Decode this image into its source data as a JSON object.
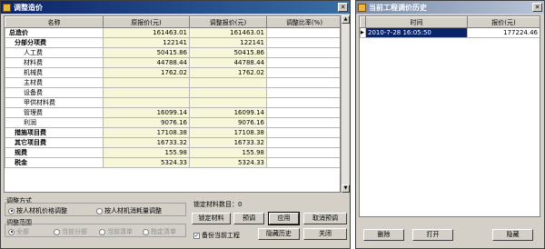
{
  "main_window": {
    "title": "调整造价",
    "columns": [
      "名称",
      "原报价(元)",
      "调整报价(元)",
      "调整比率(%)"
    ],
    "rows": [
      {
        "name": "总造价",
        "orig": "161463.01",
        "adj": "161463.01",
        "level": 1,
        "bold": true
      },
      {
        "name": "分部分项费",
        "orig": "122141",
        "adj": "122141",
        "level": 2,
        "bold": true
      },
      {
        "name": "人工费",
        "orig": "50415.86",
        "adj": "50415.86",
        "level": 3,
        "bold": false
      },
      {
        "name": "材料费",
        "orig": "44788.44",
        "adj": "44788.44",
        "level": 3,
        "bold": false
      },
      {
        "name": "机械费",
        "orig": "1762.02",
        "adj": "1762.02",
        "level": 3,
        "bold": false
      },
      {
        "name": "主材费",
        "orig": "",
        "adj": "",
        "level": 3,
        "bold": false
      },
      {
        "name": "设备费",
        "orig": "",
        "adj": "",
        "level": 3,
        "bold": false
      },
      {
        "name": "甲供材料费",
        "orig": "",
        "adj": "",
        "level": 3,
        "bold": false
      },
      {
        "name": "管理费",
        "orig": "16099.14",
        "adj": "16099.14",
        "level": 3,
        "bold": false
      },
      {
        "name": "利润",
        "orig": "9076.16",
        "adj": "9076.16",
        "level": 3,
        "bold": false
      },
      {
        "name": "措施项目费",
        "orig": "17108.38",
        "adj": "17108.38",
        "level": 2,
        "bold": true
      },
      {
        "name": "其它项目费",
        "orig": "16733.32",
        "adj": "16733.32",
        "level": 2,
        "bold": true
      },
      {
        "name": "规费",
        "orig": "155.98",
        "adj": "155.98",
        "level": 2,
        "bold": true
      },
      {
        "name": "税金",
        "orig": "5324.33",
        "adj": "5324.33",
        "level": 2,
        "bold": true
      }
    ],
    "adjust_method": {
      "label": "调整方式",
      "option_price": "按人材机价格调整",
      "option_qty": "按人材机消耗量调整"
    },
    "adjust_range": {
      "label": "调整范围",
      "options": [
        "全部",
        "当前分部",
        "当前清单",
        "指定清单"
      ]
    },
    "locked_count_label": "锁定材料数目：0",
    "buttons": {
      "lock_material": "锁定材料",
      "preview": "预调",
      "apply": "应用",
      "cancel_preview": "取消预调",
      "backup_label": "备份当前工程",
      "hide_history": "隐藏历史",
      "close": "关闭"
    }
  },
  "history_window": {
    "title": "当前工程调价历史",
    "columns": [
      "时间",
      "报价(元)"
    ],
    "rows": [
      {
        "time": "2010-7-28 16:05:50",
        "price": "177224.46"
      }
    ],
    "buttons": {
      "delete": "删除",
      "open": "打开",
      "hide": "隐藏"
    }
  }
}
